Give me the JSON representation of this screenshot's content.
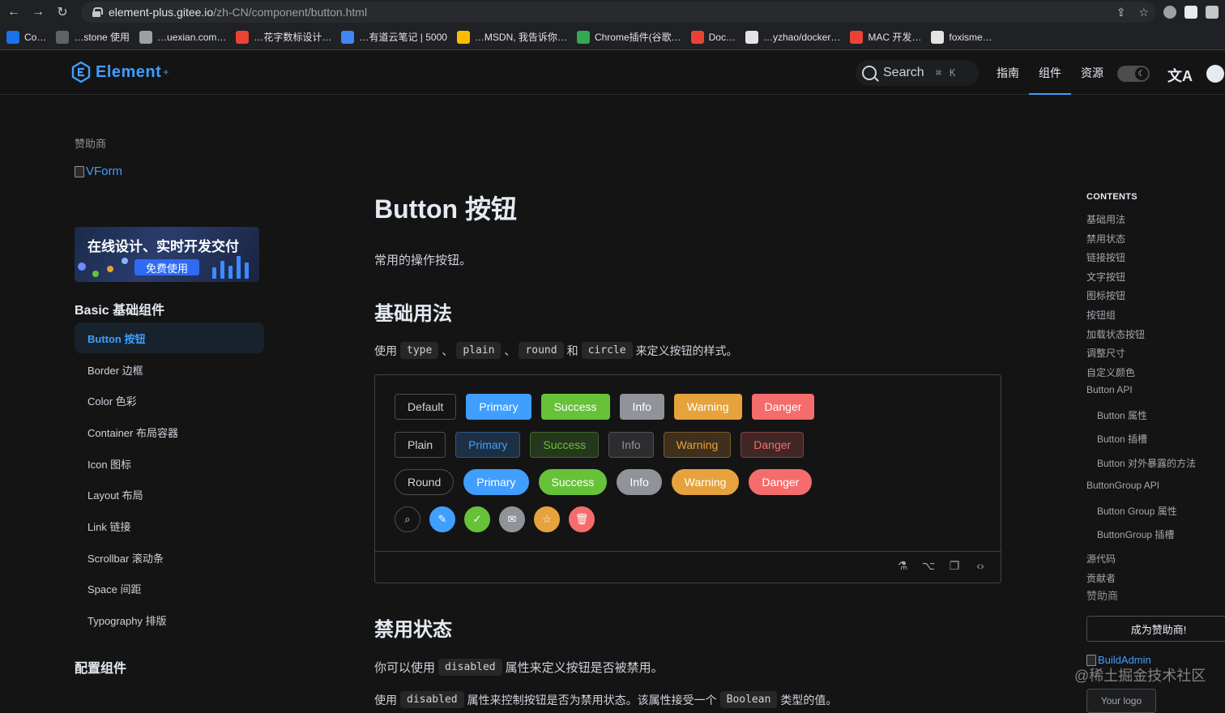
{
  "browser": {
    "url_host": "element-plus.gitee.io",
    "url_path": "/zh-CN/component/button.html",
    "bookmarks": [
      {
        "label": "Co…",
        "color": "#1a73e8"
      },
      {
        "label": "…stone 使用",
        "color": "#5f6368"
      },
      {
        "label": "…uexian.com…",
        "color": "#9aa0a6"
      },
      {
        "label": "…花字数标设计…",
        "color": "#ea4335"
      },
      {
        "label": "…有道云笔记 | 5000",
        "color": "#4285f4"
      },
      {
        "label": "…MSDN, 我告诉你…",
        "color": "#fbbc04"
      },
      {
        "label": "Chrome插件(谷歌…",
        "color": "#34a853"
      },
      {
        "label": "Doc…",
        "color": "#ea4335"
      },
      {
        "label": "…yzhao/docker…",
        "color": "#e3e3e3"
      },
      {
        "label": "MAC 开发…",
        "color": "#ea4335"
      },
      {
        "label": "foxisme…",
        "color": "#e3e3e3"
      }
    ]
  },
  "header": {
    "logo_text": "Element",
    "logo_sup": "+",
    "search_label": "Search",
    "search_kbd_1": "⌘",
    "search_kbd_2": "K",
    "nav": [
      "指南",
      "组件",
      "资源"
    ]
  },
  "sidebar": {
    "sponsor_title": "赞助商",
    "vform_label": "VForm",
    "banner_title": "在线设计、实时开发交付",
    "banner_button": "免费使用",
    "group_basic": "Basic 基础组件",
    "items": [
      "Button 按钮",
      "Border 边框",
      "Color 色彩",
      "Container 布局容器",
      "Icon 图标",
      "Layout 布局",
      "Link 链接",
      "Scrollbar 滚动条",
      "Space 间距",
      "Typography 排版"
    ],
    "group_config": "配置组件"
  },
  "main": {
    "title": "Button 按钮",
    "lead": "常用的操作按钮。",
    "section1_title": "基础用法",
    "section1_text_a": "使用",
    "code_type": "type",
    "sep1": "、",
    "code_plain": "plain",
    "sep2": "、",
    "code_round": "round",
    "and": "和",
    "code_circle": "circle",
    "section1_text_b": "来定义按钮的样式。",
    "buttons": [
      "Default",
      "Primary",
      "Success",
      "Info",
      "Warning",
      "Danger"
    ],
    "plain_buttons": [
      "Plain",
      "Primary",
      "Success",
      "Info",
      "Warning",
      "Danger"
    ],
    "round_buttons": [
      "Round",
      "Primary",
      "Success",
      "Info",
      "Warning",
      "Danger"
    ],
    "section2_title": "禁用状态",
    "section2_text_a": "你可以使用",
    "code_disabled": "disabled",
    "section2_text_b": "属性来定义按钮是否被禁用。",
    "section2_text2_a": "使用",
    "section2_text2_b": "属性来控制按钮是否为禁用状态。该属性接受一个",
    "code_boolean": "Boolean",
    "section2_text2_c": "类型的值。"
  },
  "colors": {
    "primary": "#409eff",
    "success": "#67c23a",
    "info": "#909399",
    "warning": "#e6a23c",
    "danger": "#f56c6c"
  },
  "toc": {
    "title": "CONTENTS",
    "items": [
      {
        "label": "基础用法",
        "level": 1
      },
      {
        "label": "禁用状态",
        "level": 1
      },
      {
        "label": "链接按钮",
        "level": 1
      },
      {
        "label": "文字按钮",
        "level": 1
      },
      {
        "label": "图标按钮",
        "level": 1
      },
      {
        "label": "按钮组",
        "level": 1
      },
      {
        "label": "加载状态按钮",
        "level": 1
      },
      {
        "label": "调整尺寸",
        "level": 1
      },
      {
        "label": "自定义颜色",
        "level": 1
      },
      {
        "label": "Button API",
        "level": 1
      },
      {
        "label": "Button 属性",
        "level": 2
      },
      {
        "label": "Button 插槽",
        "level": 2
      },
      {
        "label": "Button 对外暴露的方法",
        "level": 2
      },
      {
        "label": "ButtonGroup API",
        "level": 1
      },
      {
        "label": "Button Group 属性",
        "level": 2
      },
      {
        "label": "ButtonGroup 插槽",
        "level": 2
      },
      {
        "label": "源代码",
        "level": 1
      },
      {
        "label": "贡献者",
        "level": 1
      }
    ],
    "sponsor_title": "赞助商",
    "sponsor_button": "成为赞助商!",
    "sponsor_logo": "BuildAdmin",
    "your_logo": "Your logo",
    "watermark": "@稀土掘金技术社区"
  }
}
